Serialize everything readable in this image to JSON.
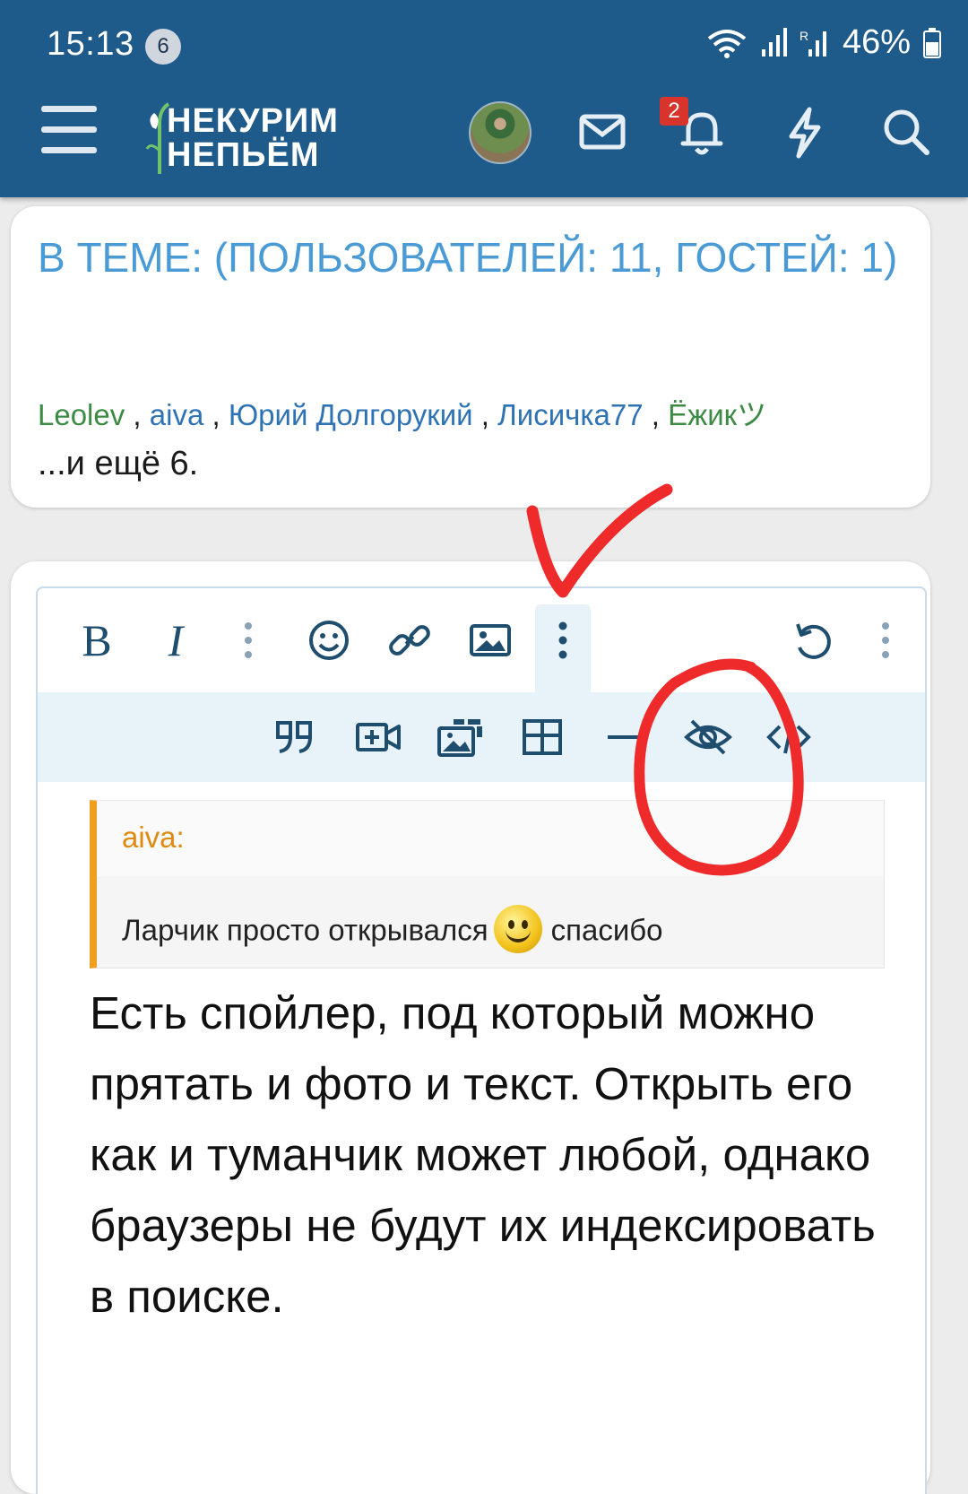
{
  "status_bar": {
    "time": "15:13",
    "notification_count": "6",
    "battery": "46%"
  },
  "header": {
    "logo_line1": "НЕКУРИМ",
    "logo_line2": "НЕПЬЁМ",
    "alerts_count": "2",
    "brand_color": "#1e5a8a"
  },
  "online": {
    "title": "В ТЕМЕ: (ПОЛЬЗОВАТЕЛЕЙ: 11, ГОСТЕЙ: 1)",
    "users": [
      "Leolev",
      "aiva",
      "Юрий Долгорукий",
      "Лисичка77",
      "Ёжикツ"
    ],
    "separator": " , ",
    "more": "...и ещё 6."
  },
  "editor": {
    "toolbar_row1": [
      "bold-icon",
      "italic-icon",
      "more-text-icon",
      "smiley-icon",
      "link-icon",
      "image-icon",
      "more-insert-icon",
      "undo-icon",
      "more-options-icon"
    ],
    "toolbar_row2": [
      "quote-icon",
      "media-icon",
      "gallery-icon",
      "table-icon",
      "horizontal-line-icon",
      "spoiler-icon",
      "code-icon"
    ],
    "bold_label": "B",
    "italic_label": "I",
    "quote": {
      "author": "aiva:",
      "text_before": "Ларчик просто открывался",
      "text_after": "спасибо"
    },
    "body": "Есть спойлер, под который можно прятать и фото и текст. Открыть его как и туманчик может любой, однако браузеры не будут их индексировать в поиске."
  },
  "colors": {
    "accent_blue": "#4a9ad6",
    "quote_bar": "#f0a020",
    "annotation_red": "#ee2a2a"
  }
}
